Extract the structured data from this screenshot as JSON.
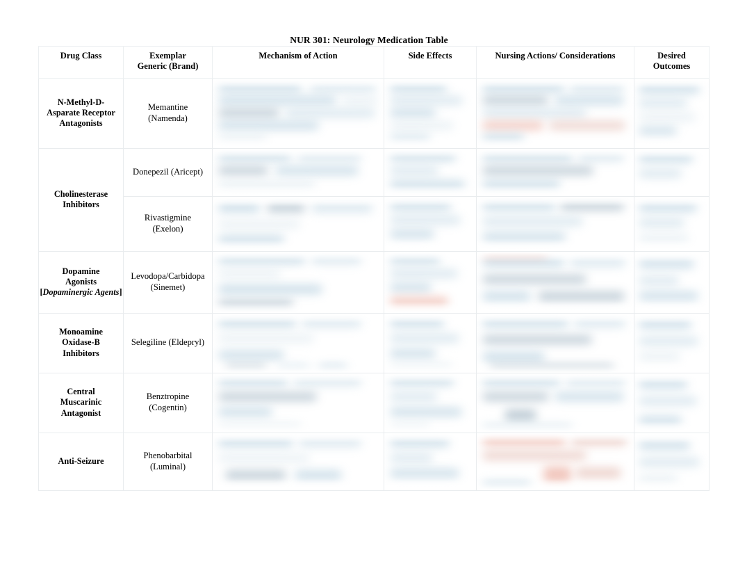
{
  "document": {
    "title": "NUR 301: Neurology Medication Table"
  },
  "table": {
    "headers": [
      "Drug Class",
      "Exemplar\nGeneric (Brand)",
      "Mechanism of Action",
      "Side Effects",
      "Nursing Actions/ Considerations",
      "Desired\nOutcomes"
    ],
    "header_parts": {
      "drug_class": "Drug Class",
      "exemplar_line1": "Exemplar",
      "exemplar_line2": "Generic (Brand)",
      "mechanism": "Mechanism of Action",
      "side_effects": "Side Effects",
      "nursing": "Nursing Actions/ Considerations",
      "outcomes_line1": "Desired",
      "outcomes_line2": "Outcomes"
    },
    "rows": [
      {
        "drug_class": "N-Methyl-D-Asparate Receptor Antagonists",
        "drug_class_lines": [
          "N-Methyl-D-",
          "Asparate Receptor",
          "Antagonists"
        ],
        "exemplar": "Memantine (Namenda)",
        "exemplar_lines": [
          "Memantine",
          "(Namenda)"
        ],
        "mechanism_of_action": "",
        "side_effects": "",
        "nursing_actions": "",
        "desired_outcomes": ""
      },
      {
        "drug_class": "Cholinesterase Inhibitors",
        "drug_class_lines": [
          "Cholinesterase",
          "Inhibitors"
        ],
        "exemplar": "Donepezil (Aricept)",
        "exemplar_lines": [
          "Donepezil (Aricept)"
        ],
        "mechanism_of_action": "",
        "side_effects": "",
        "nursing_actions": "",
        "desired_outcomes": ""
      },
      {
        "drug_class": "",
        "exemplar": "Rivastigmine (Exelon)",
        "exemplar_lines": [
          "Rivastigmine",
          "(Exelon)"
        ],
        "mechanism_of_action": "",
        "side_effects": "",
        "nursing_actions": "",
        "desired_outcomes": ""
      },
      {
        "drug_class": "Dopamine Agonists [Dopaminergic Agents]",
        "drug_class_lines": [
          "Dopamine",
          "Agonists"
        ],
        "drug_class_alt_prefix": "[",
        "drug_class_alt": "Dopaminergic Agents",
        "drug_class_alt_suffix": "]",
        "exemplar": "Levodopa/Carbidopa (Sinemet)",
        "exemplar_lines": [
          "Levodopa/Carbidopa",
          "(Sinemet)"
        ],
        "mechanism_of_action": "",
        "side_effects": "",
        "nursing_actions": "",
        "desired_outcomes": ""
      },
      {
        "drug_class": "Monoamine Oxidase-B Inhibitors",
        "drug_class_lines": [
          "Monoamine",
          "Oxidase-B",
          "Inhibitors"
        ],
        "exemplar": "Selegiline (Eldepryl)",
        "exemplar_lines": [
          "Selegiline (Eldepryl)"
        ],
        "mechanism_of_action": "",
        "side_effects": "",
        "nursing_actions": "",
        "desired_outcomes": ""
      },
      {
        "drug_class": "Central Muscarinic Antagonist",
        "drug_class_lines": [
          "Central",
          "Muscarinic",
          "Antagonist"
        ],
        "exemplar": "Benztropine (Cogentin)",
        "exemplar_lines": [
          "Benztropine",
          "(Cogentin)"
        ],
        "mechanism_of_action": "",
        "side_effects": "",
        "nursing_actions": "",
        "desired_outcomes": ""
      },
      {
        "drug_class": "Anti-Seizure",
        "drug_class_lines": [
          "Anti-Seizure"
        ],
        "exemplar": "Phenobarbital (Luminal)",
        "exemplar_lines": [
          "Phenobarbital",
          "(Luminal)"
        ],
        "mechanism_of_action": "",
        "side_effects": "",
        "nursing_actions": "",
        "desired_outcomes": ""
      }
    ]
  },
  "colors": {
    "page_background": "#ffffff",
    "text": "#000000",
    "border": "#e9ecee",
    "redaction_blue": "#bdd4e2",
    "redaction_red": "#eeb9ad"
  }
}
